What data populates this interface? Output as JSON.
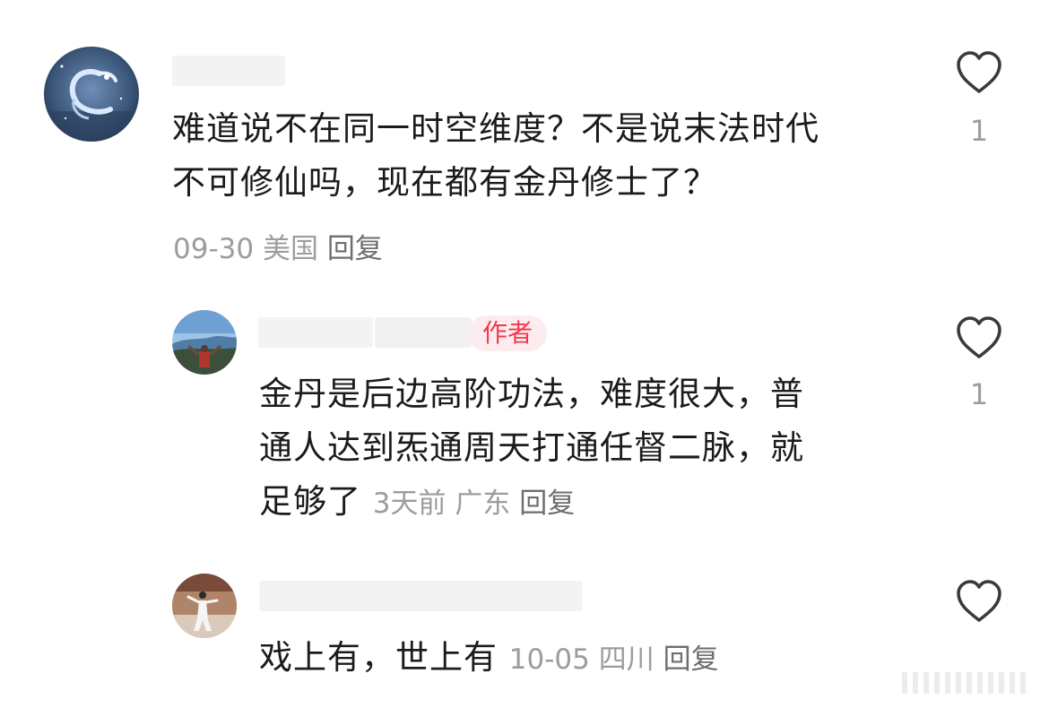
{
  "comments": [
    {
      "text_lines": [
        "难道说不在同一时空维度？不是说末法时代",
        "不可修仙吗，现在都有金丹修士了？"
      ],
      "date": "09-30",
      "location": "美国",
      "reply_label": "回复",
      "like_count": "1",
      "avatar_icon": "dragon-avatar-icon"
    },
    {
      "badge": "作者",
      "text_lines": [
        "金丹是后边高阶功法，难度很大，普",
        "通人达到炁通周天打通任督二脉，就",
        "足够了"
      ],
      "date": "3天前",
      "location": "广东",
      "reply_label": "回复",
      "like_count": "1",
      "avatar_icon": "landscape-avatar-icon"
    },
    {
      "text_lines": [
        "戏上有，世上有"
      ],
      "date": "10-05",
      "location": "四川",
      "reply_label": "回复",
      "like_count": "",
      "avatar_icon": "taichi-avatar-icon"
    }
  ],
  "colors": {
    "text": "#1b1b1b",
    "meta": "#9c9c9c",
    "badge_text": "#f2384f",
    "badge_bg": "#fdecef"
  }
}
